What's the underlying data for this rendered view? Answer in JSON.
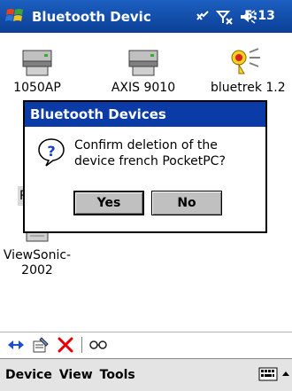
{
  "titlebar": {
    "title": "Bluetooth Devic",
    "time": "5:13"
  },
  "devices": [
    {
      "label": "1050AP",
      "icon": "printer-icon"
    },
    {
      "label": "AXIS 9010",
      "icon": "printer-icon"
    },
    {
      "label": "bluetrek 1.2",
      "icon": "headset-speaker-icon"
    },
    {
      "label": "ViewSonic-\n2002",
      "line1": "ViewSonic-",
      "line2": "2002",
      "icon": "device-icon"
    }
  ],
  "partial_item_letter": "P",
  "dialog": {
    "title": "Bluetooth Devices",
    "message": "Confirm deletion of the device french PocketPC?",
    "yes_label": "Yes",
    "no_label": "No"
  },
  "menubar": {
    "items": [
      "Device",
      "View",
      "Tools"
    ]
  },
  "colors": {
    "titlebar": "#0b3f96",
    "dialog_title": "#0a3ba7",
    "delete_red": "#e00000"
  }
}
